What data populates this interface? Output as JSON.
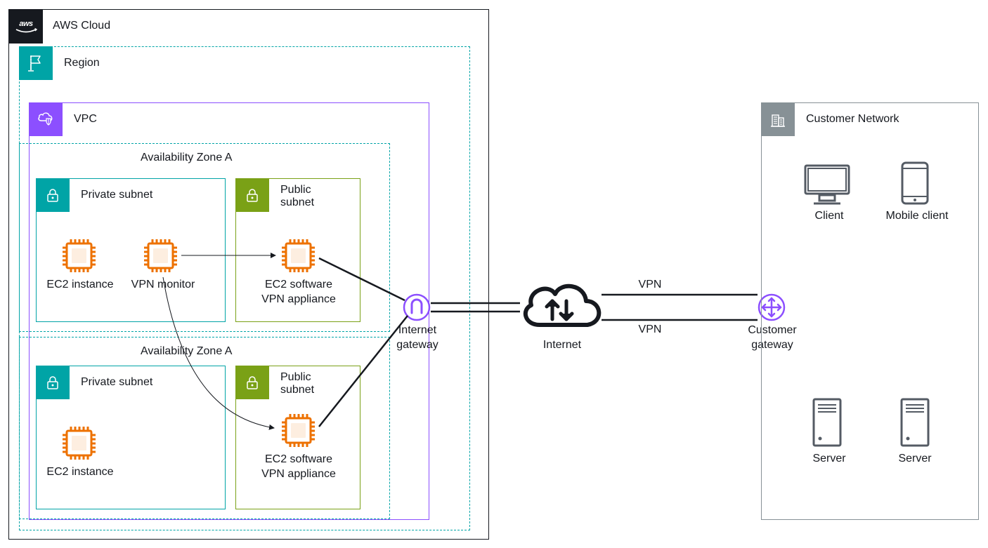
{
  "cloud": {
    "label": "AWS Cloud",
    "logo_text": "aws"
  },
  "region": {
    "label": "Region"
  },
  "vpc": {
    "label": "VPC"
  },
  "az1": {
    "label": "Availability Zone A"
  },
  "az2": {
    "label": "Availability Zone A"
  },
  "priv_subnet_label": "Private subnet",
  "pub_subnet_label": "Public subnet",
  "ec2_label": "EC2 instance",
  "vpn_monitor_label": "VPN monitor",
  "vpn_appliance_label_line1": "EC2 software",
  "vpn_appliance_label_line2": "VPN appliance",
  "igw": {
    "label": "Internet gateway"
  },
  "internet": {
    "label": "Internet"
  },
  "vpn_text": "VPN",
  "cgw": {
    "label": "Customer gateway"
  },
  "customer_network": {
    "label": "Customer Network",
    "client_label": "Client",
    "mobile_label": "Mobile client",
    "server_label": "Server"
  },
  "colors": {
    "black": "#16191f",
    "teal": "#00A4A6",
    "purple": "#8C4FFF",
    "olive": "#7AA116",
    "orange": "#ED7100",
    "grey": "#879196",
    "darkgrey": "#545B64"
  }
}
